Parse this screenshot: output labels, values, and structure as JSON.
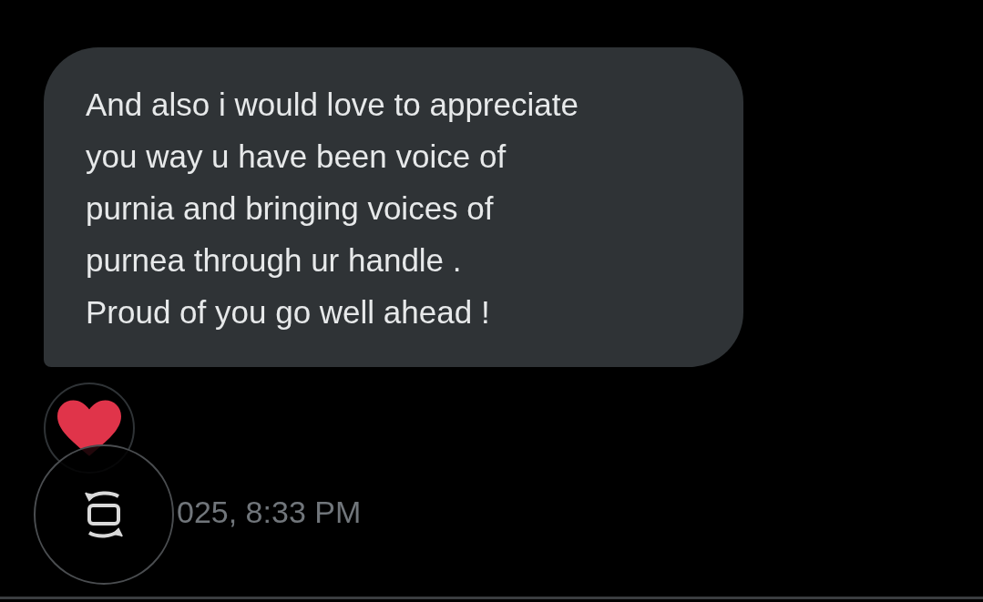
{
  "message": {
    "text": "And also i would love to appreciate\nyou way u have been voice of\npurnia and bringing voices of\npurnea through ur handle .\nProud of you go well ahead !"
  },
  "reaction": {
    "kind": "heart"
  },
  "timestamp": "025, 8:33 PM"
}
